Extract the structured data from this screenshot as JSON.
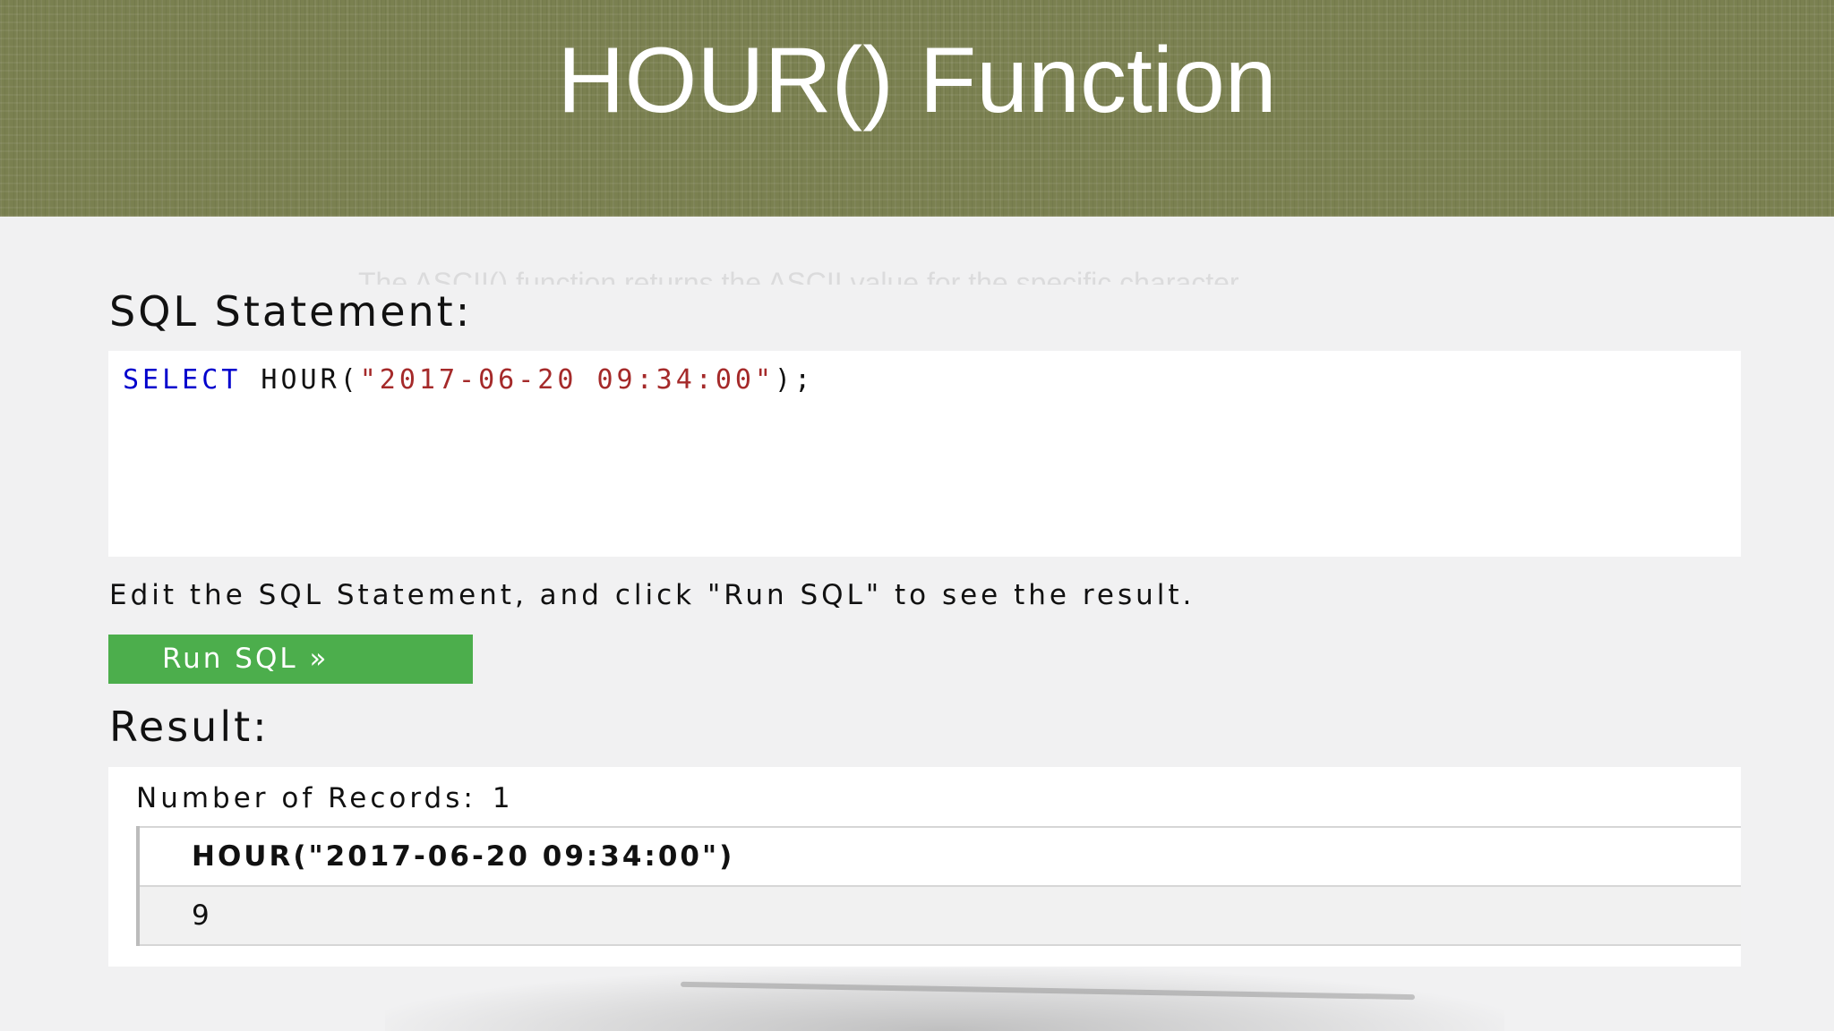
{
  "slide": {
    "title": "HOUR() Function",
    "faded_text": "The ASCII() function returns the ASCII value for the specific character."
  },
  "editor": {
    "heading": "SQL Statement:",
    "code": {
      "keyword": "SELECT",
      "function": " HOUR(",
      "string": "\"2017-06-20 09:34:00\"",
      "end": ");"
    },
    "instruction": "Edit the SQL Statement, and click \"Run SQL\" to see the result.",
    "run_button_label": "Run SQL »"
  },
  "result": {
    "heading": "Result:",
    "records_label": "Number of Records:",
    "records_count": "1",
    "columns": [
      "HOUR(\"2017-06-20 09:34:00\")"
    ],
    "rows": [
      [
        "9"
      ]
    ]
  },
  "colors": {
    "title_bar": "#7a8050",
    "button": "#4cae4c",
    "sql_keyword": "#0000cd",
    "sql_string": "#a52a2a"
  }
}
